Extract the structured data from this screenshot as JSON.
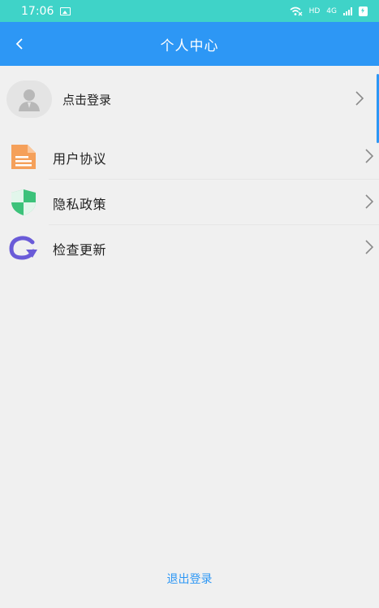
{
  "status_bar": {
    "time": "17:06",
    "network": "HD",
    "signal_label": "4G"
  },
  "header": {
    "title": "个人中心"
  },
  "profile": {
    "login_label": "点击登录"
  },
  "menu": [
    {
      "label": "用户协议",
      "icon": "document-icon",
      "color": "#f5a05a"
    },
    {
      "label": "隐私政策",
      "icon": "shield-icon",
      "color": "#3cc27a"
    },
    {
      "label": "检查更新",
      "icon": "refresh-arrow-icon",
      "color": "#6a5bd8"
    }
  ],
  "footer": {
    "logout_label": "退出登录"
  },
  "colors": {
    "status_bar": "#3fd3c8",
    "nav_bar": "#2d97f5",
    "background": "#f0f0f0",
    "link": "#2d97f5"
  }
}
